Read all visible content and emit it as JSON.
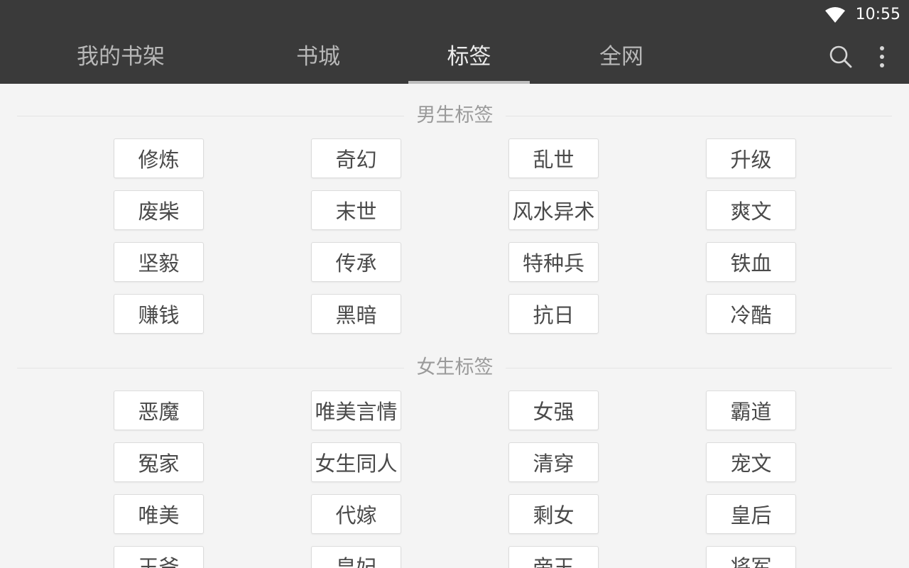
{
  "status_bar": {
    "time": "10:55"
  },
  "tabs": [
    {
      "label": "我的书架",
      "active": false
    },
    {
      "label": "书城",
      "active": false
    },
    {
      "label": "标签",
      "active": true
    },
    {
      "label": "全网",
      "active": false
    }
  ],
  "toolbar": {
    "icons": [
      "search-icon",
      "more-vert-icon"
    ]
  },
  "male_section": {
    "title": "男生标签",
    "tags": [
      "修炼",
      "奇幻",
      "乱世",
      "升级",
      "废柴",
      "末世",
      "风水异术",
      "爽文",
      "坚毅",
      "传承",
      "特种兵",
      "铁血",
      "赚钱",
      "黑暗",
      "抗日",
      "冷酷"
    ]
  },
  "female_section": {
    "title": "女生标签",
    "tags": [
      "恶魔",
      "唯美言情",
      "女强",
      "霸道",
      "冤家",
      "女生同人",
      "清穿",
      "宠文",
      "唯美",
      "代嫁",
      "剩女",
      "皇后",
      "王爷",
      "皇妃",
      "帝王",
      "将军"
    ]
  },
  "colors": {
    "toolbar_bg": "#3a3a3a",
    "page_bg": "#f4f4f4",
    "tag_text": "#4a4a4a",
    "section_title": "#9a9a9a"
  }
}
